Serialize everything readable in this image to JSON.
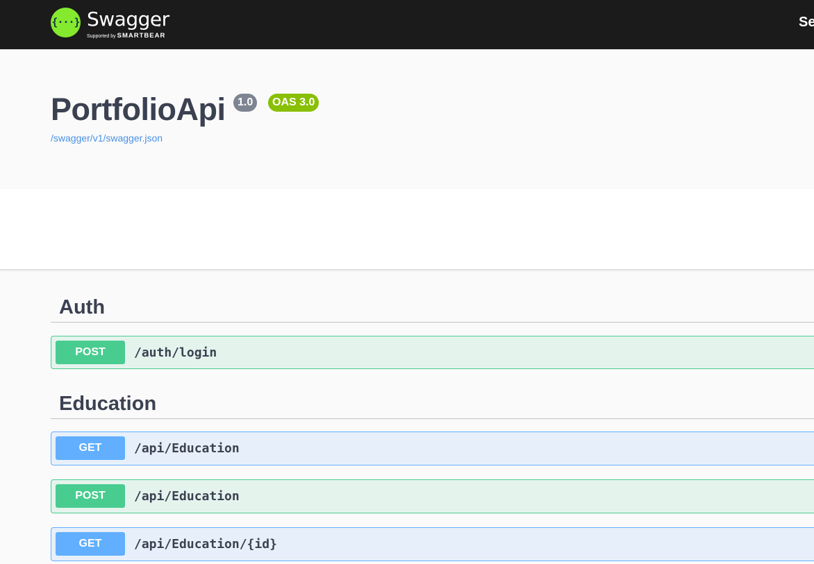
{
  "topbar": {
    "logo_glyph": "{···}",
    "logo_word": "Swagger",
    "logo_tm": "™",
    "logo_sub_prefix": "Supported by",
    "logo_sub_brand": "SMARTBEAR",
    "right_text": "Se"
  },
  "info": {
    "title": "PortfolioApi",
    "version_badge": "1.0",
    "oas_badge": "OAS 3.0",
    "spec_link": "/swagger/v1/swagger.json"
  },
  "tags": [
    {
      "name": "Auth",
      "operations": [
        {
          "method": "POST",
          "path": "/auth/login"
        }
      ]
    },
    {
      "name": "Education",
      "operations": [
        {
          "method": "GET",
          "path": "/api/Education"
        },
        {
          "method": "POST",
          "path": "/api/Education"
        },
        {
          "method": "GET",
          "path": "/api/Education/{id}"
        }
      ]
    }
  ],
  "colors": {
    "topbar_bg": "#1b1b1b",
    "logo_green": "#85ea2d",
    "post_green": "#49cc90",
    "get_blue": "#61affe",
    "version_badge_gray": "#7d8492",
    "oas_badge_green": "#89bf04",
    "link_blue": "#4990e2",
    "text_dark": "#3b4151"
  },
  "icons": {
    "logo": "swagger-logo-icon"
  }
}
